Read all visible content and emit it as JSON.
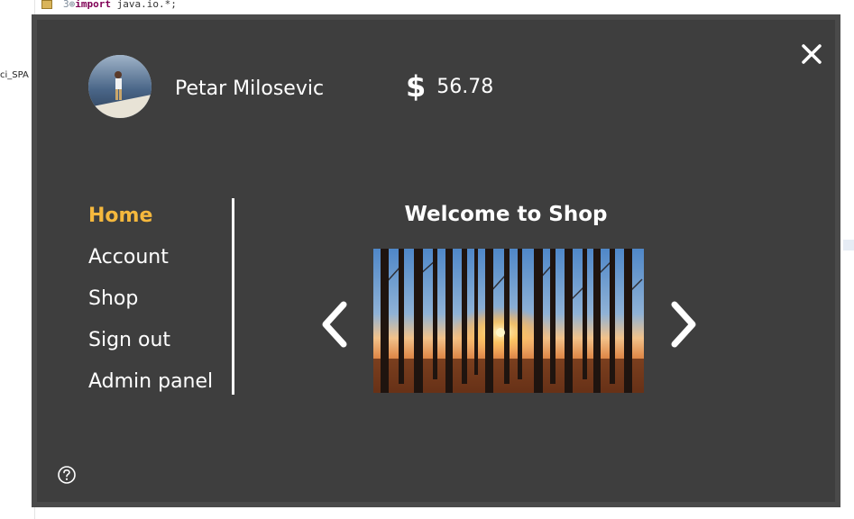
{
  "ide": {
    "code_line_number": "3",
    "code_keyword": "import",
    "code_rest": " java.io.*;",
    "side_label": "ci_SPA",
    "bottom_fragment": ""
  },
  "dialog": {
    "close_icon": "close-icon",
    "user": {
      "name": "Petar Milosevic",
      "avatar_icon": "avatar"
    },
    "balance": {
      "currency_symbol": "$",
      "value": "56.78"
    },
    "nav": {
      "items": [
        {
          "label": "Home",
          "active": true
        },
        {
          "label": "Account",
          "active": false
        },
        {
          "label": "Shop",
          "active": false
        },
        {
          "label": "Sign out",
          "active": false
        },
        {
          "label": "Admin panel",
          "active": false
        }
      ]
    },
    "main": {
      "title": "Welcome to Shop",
      "carousel": {
        "prev_icon": "chevron-left-icon",
        "next_icon": "chevron-right-icon",
        "image_subject": "forest-sunset"
      }
    },
    "help_icon": "help-icon"
  },
  "colors": {
    "dialog_bg": "#3e3e3e",
    "accent": "#f5b83d",
    "text": "#ffffff"
  }
}
